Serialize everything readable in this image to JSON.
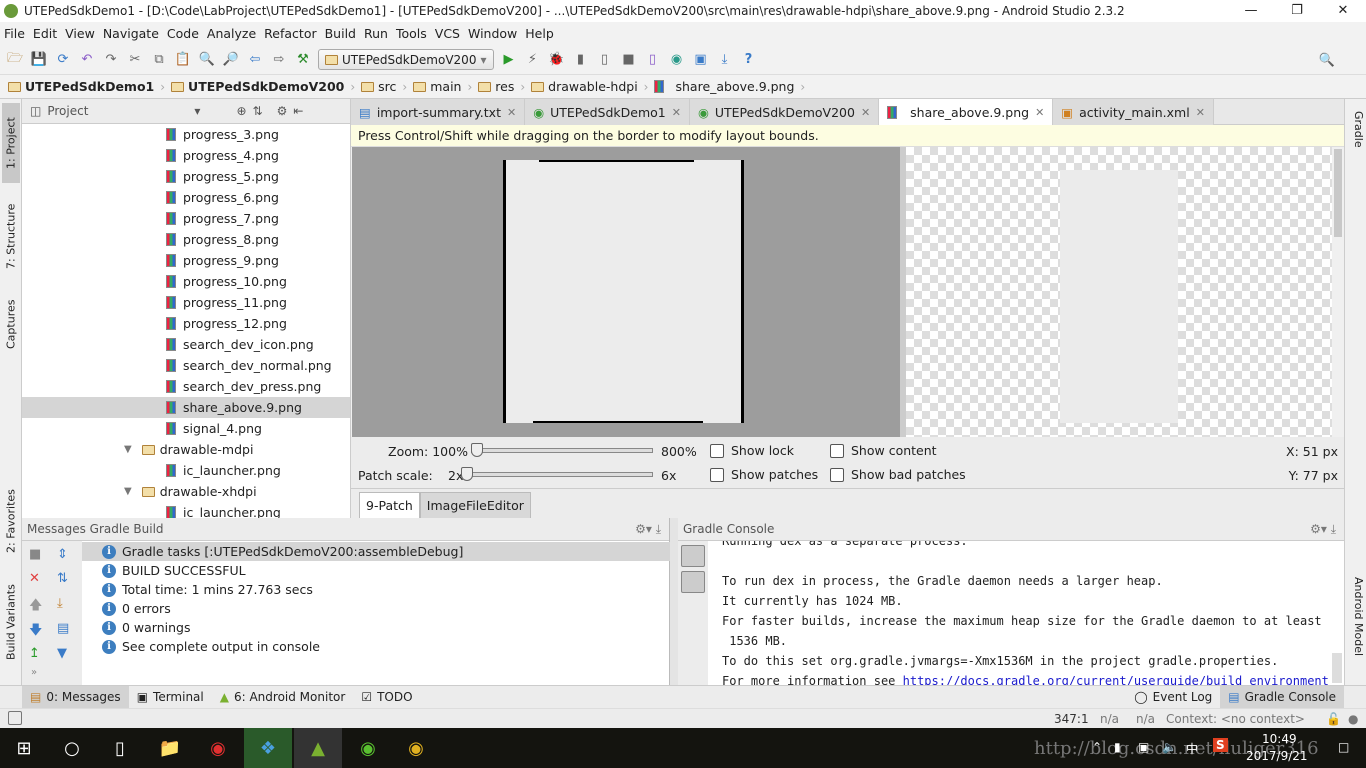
{
  "title": "UTEPedSdkDemo1 - [D:\\Code\\LabProject\\UTEPedSdkDemo1] - [UTEPedSdkDemoV200] - ...\\UTEPedSdkDemoV200\\src\\main\\res\\drawable-hdpi\\share_above.9.png - Android Studio 2.3.2",
  "window_controls": [
    "minimize",
    "restore",
    "close"
  ],
  "menu": [
    "File",
    "Edit",
    "View",
    "Navigate",
    "Code",
    "Analyze",
    "Refactor",
    "Build",
    "Run",
    "Tools",
    "VCS",
    "Window",
    "Help"
  ],
  "toolbar": {
    "run_config": "UTEPedSdkDemoV200",
    "icons": [
      "open-icon",
      "save-icon",
      "sync-icon",
      "undo-icon",
      "redo-icon",
      "cut-icon",
      "copy-icon",
      "paste-icon",
      "find-icon",
      "replace-icon",
      "back-icon",
      "forward-icon",
      "make-icon",
      "run-icon",
      "apply-changes-icon",
      "debug-icon",
      "profile-icon",
      "attach-debugger-icon",
      "stop-icon",
      "avd-manager-icon",
      "gradle-sync-icon",
      "project-structure-icon",
      "sdk-manager-icon",
      "help-icon",
      "search-icon"
    ]
  },
  "breadcrumbs": [
    "UTEPedSdkDemo1",
    "UTEPedSdkDemoV200",
    "src",
    "main",
    "res",
    "drawable-hdpi",
    "share_above.9.png"
  ],
  "left_strip": [
    "1: Project",
    "7: Structure",
    "Captures",
    "2: Favorites",
    "Build Variants"
  ],
  "right_strip": [
    "Gradle",
    "Android Model"
  ],
  "project": {
    "view": "Project",
    "items": [
      {
        "label": "progress_3.png",
        "type": "file"
      },
      {
        "label": "progress_4.png",
        "type": "file"
      },
      {
        "label": "progress_5.png",
        "type": "file"
      },
      {
        "label": "progress_6.png",
        "type": "file"
      },
      {
        "label": "progress_7.png",
        "type": "file"
      },
      {
        "label": "progress_8.png",
        "type": "file"
      },
      {
        "label": "progress_9.png",
        "type": "file"
      },
      {
        "label": "progress_10.png",
        "type": "file"
      },
      {
        "label": "progress_11.png",
        "type": "file"
      },
      {
        "label": "progress_12.png",
        "type": "file"
      },
      {
        "label": "search_dev_icon.png",
        "type": "file"
      },
      {
        "label": "search_dev_normal.png",
        "type": "file"
      },
      {
        "label": "search_dev_press.png",
        "type": "file"
      },
      {
        "label": "share_above.9.png",
        "type": "file",
        "selected": true
      },
      {
        "label": "signal_4.png",
        "type": "file"
      },
      {
        "label": "drawable-mdpi",
        "type": "folder"
      },
      {
        "label": "ic_launcher.png",
        "type": "file"
      },
      {
        "label": "drawable-xhdpi",
        "type": "folder"
      },
      {
        "label": "ic_launcher.png",
        "type": "file"
      }
    ]
  },
  "editor_tabs": [
    {
      "label": "import-summary.txt"
    },
    {
      "label": "UTEPedSdkDemo1"
    },
    {
      "label": "UTEPedSdkDemoV200"
    },
    {
      "label": "share_above.9.png",
      "active": true
    },
    {
      "label": "activity_main.xml"
    }
  ],
  "hint": "Press Control/Shift while dragging on the border to modify layout bounds.",
  "ninepatch": {
    "zoom_label": "Zoom: 100%",
    "zoom_max": "800%",
    "zoom_value_percent": 100,
    "patch_label": "Patch scale:",
    "patch_min": "2x",
    "patch_max": "6x",
    "patch_value": 2,
    "checkboxes": [
      {
        "label": "Show lock",
        "checked": false
      },
      {
        "label": "Show content",
        "checked": false
      },
      {
        "label": "Show patches",
        "checked": false
      },
      {
        "label": "Show bad patches",
        "checked": false
      }
    ],
    "x_readout": "X: 51 px",
    "y_readout": "Y: 77 px"
  },
  "editor_bottom_tabs": [
    {
      "label": "9-Patch",
      "active": true
    },
    {
      "label": "ImageFileEditor"
    }
  ],
  "messages": {
    "title": "Messages Gradle Build",
    "rows": [
      "Gradle tasks [:UTEPedSdkDemoV200:assembleDebug]",
      "BUILD SUCCESSFUL",
      "Total time: 1 mins 27.763 secs",
      "0 errors",
      "0 warnings",
      "See complete output in console"
    ]
  },
  "gradle_console": {
    "title": "Gradle Console",
    "lines": [
      "Running dex as a separate process.",
      "",
      "To run dex in process, the Gradle daemon needs a larger heap.",
      "It currently has 1024 MB.",
      "For faster builds, increase the maximum heap size for the Gradle daemon to at least",
      " 1536 MB.",
      "To do this set org.gradle.jvmargs=-Xmx1536M in the project gradle.properties."
    ],
    "link_prefix": "For more information see ",
    "link": "https://docs.gradle.org/current/userguide/build_environment"
  },
  "toolwindows": {
    "left": [
      "0: Messages",
      "Terminal",
      "6: Android Monitor",
      "TODO"
    ],
    "right": [
      "Event Log",
      "Gradle Console"
    ]
  },
  "status": {
    "position": "347:1",
    "na1": "n/a",
    "na2": "n/a",
    "context": "Context: <no context>"
  },
  "taskbar": {
    "time": "10:49",
    "date": "2017/9/21",
    "ime": "中",
    "watermark": "http://blog.csdn.net/lluliger316"
  }
}
